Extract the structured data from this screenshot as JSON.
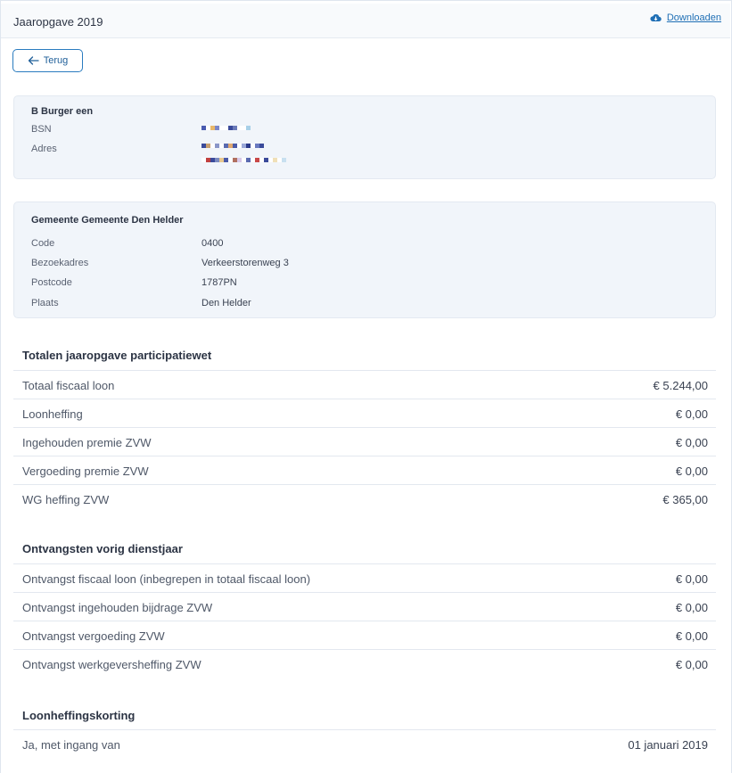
{
  "header": {
    "title": "Jaaropgave 2019",
    "download_label": "Downloaden"
  },
  "back_button": {
    "label": "Terug"
  },
  "person": {
    "name": "B Burger een",
    "bsn_label": "BSN",
    "adres_label": "Adres"
  },
  "gemeente": {
    "name": "Gemeente Gemeente Den Helder",
    "rows": [
      {
        "label": "Code",
        "value": "0400"
      },
      {
        "label": "Bezoekadres",
        "value": "Verkeerstorenweg 3"
      },
      {
        "label": "Postcode",
        "value": "1787PN"
      },
      {
        "label": "Plaats",
        "value": "Den Helder"
      }
    ]
  },
  "totalen": {
    "title": "Totalen jaaropgave participatiewet",
    "rows": [
      {
        "label": "Totaal fiscaal loon",
        "value": "€ 5.244,00"
      },
      {
        "label": "Loonheffing",
        "value": "€ 0,00"
      },
      {
        "label": "Ingehouden premie ZVW",
        "value": "€ 0,00"
      },
      {
        "label": "Vergoeding premie ZVW",
        "value": "€ 0,00"
      },
      {
        "label": "WG heffing ZVW",
        "value": "€ 365,00"
      }
    ]
  },
  "ontvangsten": {
    "title": "Ontvangsten vorig dienstjaar",
    "rows": [
      {
        "label": "Ontvangst fiscaal loon (inbegrepen in totaal fiscaal loon)",
        "value": "€ 0,00"
      },
      {
        "label": "Ontvangst ingehouden bijdrage ZVW",
        "value": "€ 0,00"
      },
      {
        "label": "Ontvangst vergoeding ZVW",
        "value": "€ 0,00"
      },
      {
        "label": "Ontvangst werkgeversheffing ZVW",
        "value": "€ 0,00"
      }
    ]
  },
  "loonheffingskorting": {
    "title": "Loonheffingskorting",
    "rows": [
      {
        "label": "Ja, met ingang van",
        "value": "01 januari 2019"
      }
    ]
  },
  "colors": {
    "accent": "#1f6fb5",
    "card_bg": "#f1f5fa",
    "divider": "#e3e8ef"
  },
  "icons": {
    "download": "cloud-download-icon",
    "back": "arrow-left-icon"
  }
}
